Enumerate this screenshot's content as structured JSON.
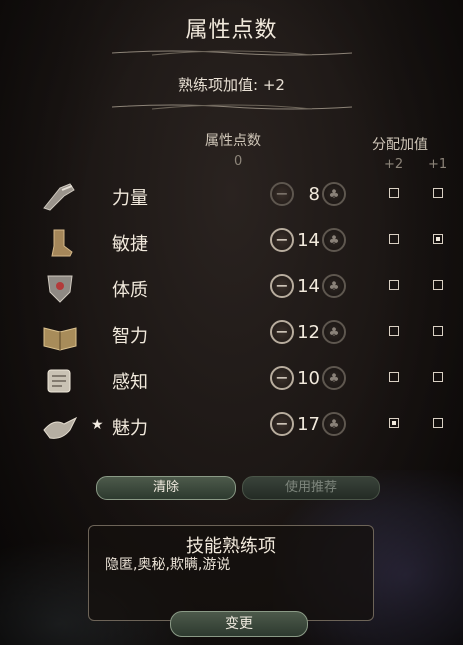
{
  "title": "属性点数",
  "proficiency_bonus": "熟练项加值: +2",
  "headers": {
    "ability_points": "属性点数",
    "points_remaining": "0",
    "allocation": "分配加值",
    "plus2": "+2",
    "plus1": "+1"
  },
  "abilities": [
    {
      "name": "力量",
      "value": "8",
      "icon": "gauntlet-icon",
      "plus2": false,
      "plus1": false
    },
    {
      "name": "敏捷",
      "value": "14",
      "icon": "boot-icon",
      "plus2": false,
      "plus1": true
    },
    {
      "name": "体质",
      "value": "14",
      "icon": "heart-shield-icon",
      "plus2": false,
      "plus1": false
    },
    {
      "name": "智力",
      "value": "12",
      "icon": "open-book-icon",
      "plus2": false,
      "plus1": false
    },
    {
      "name": "感知",
      "value": "10",
      "icon": "scroll-icon",
      "plus2": false,
      "plus1": false
    },
    {
      "name": "魅力",
      "value": "17",
      "icon": "hand-bird-icon",
      "plus2": true,
      "plus1": false,
      "starred": true
    }
  ],
  "buttons": {
    "clear": "清除",
    "use_recommended": "使用推荐",
    "change": "变更"
  },
  "skills": {
    "title": "技能熟练项",
    "list": "隐匿,奥秘,欺瞒,游说"
  }
}
